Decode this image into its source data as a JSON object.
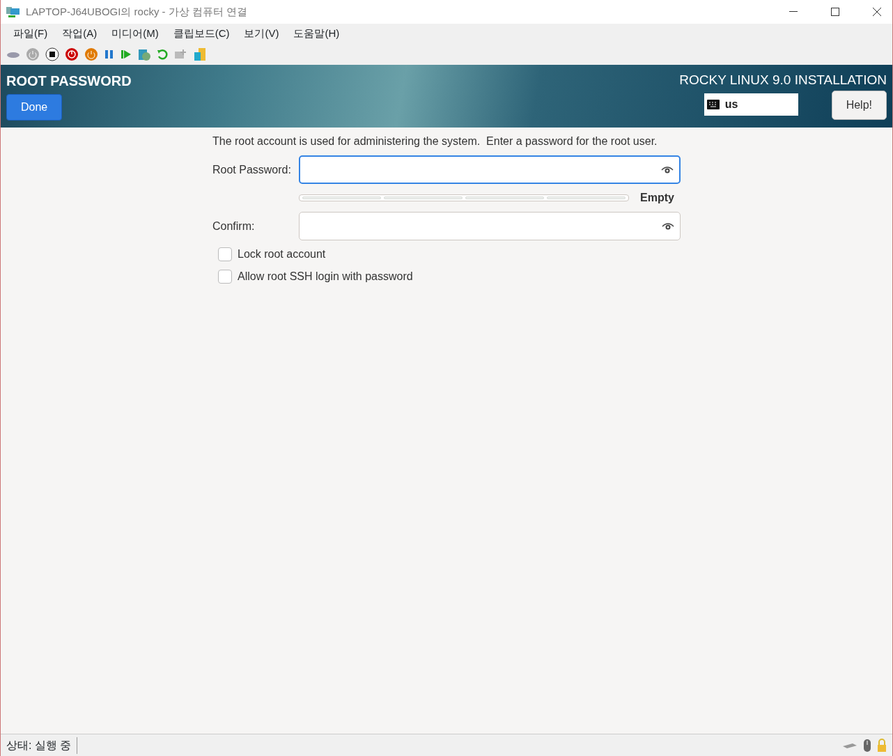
{
  "window": {
    "title": "LAPTOP-J64UBOGI의 rocky - 가상 컴퓨터 연결"
  },
  "menu": [
    "파일(F)",
    "작업(A)",
    "미디어(M)",
    "클립보드(C)",
    "보기(V)",
    "도움말(H)"
  ],
  "header": {
    "title": "ROOT PASSWORD",
    "done_button": "Done",
    "product": "ROCKY LINUX 9.0 INSTALLATION",
    "keyboard_layout": "us",
    "help_button": "Help!"
  },
  "intro": "The root account is used for administering the system.  Enter a password for the root user.",
  "fields": [
    {
      "label": "Root Password:",
      "focused": true
    },
    {
      "label": "Confirm:",
      "focused": false
    }
  ],
  "strength": {
    "reading": "Empty"
  },
  "checkboxes": [
    {
      "label": "Lock root account",
      "checked": false
    },
    {
      "label": "Allow root SSH login with password",
      "checked": false
    }
  ],
  "status_bar": {
    "text": "상태: 실행 중"
  }
}
